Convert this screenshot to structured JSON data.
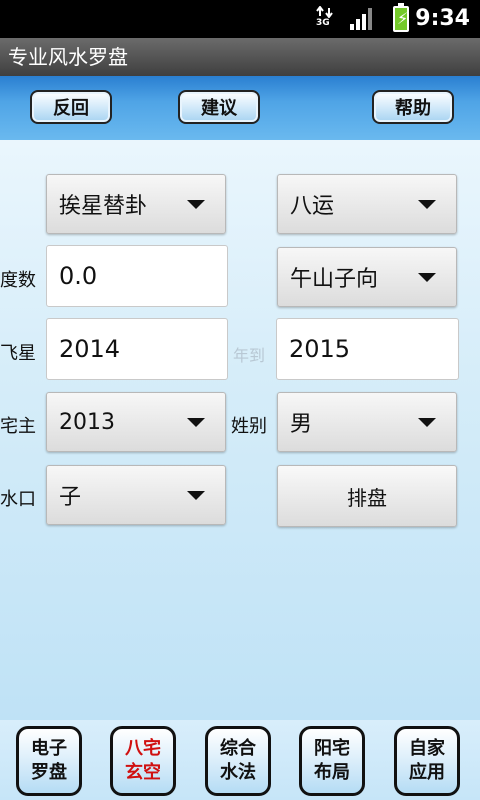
{
  "status_bar": {
    "network": "3G",
    "time": "9:34"
  },
  "app": {
    "title": "专业风水罗盘"
  },
  "toolbar": {
    "back_label": "反回",
    "suggest_label": "建议",
    "help_label": "帮助"
  },
  "form": {
    "method_select": "挨星替卦",
    "period_select": "八运",
    "degree_label": "度数",
    "degree_value": "0.0",
    "direction_select": "午山子向",
    "flystar_label": "飞星",
    "year_from": "2014",
    "year_to_label": "年到",
    "year_to": "2015",
    "owner_label": "宅主",
    "owner_year": "2013",
    "gender_label": "姓别",
    "gender_select": "男",
    "water_label": "水口",
    "water_select": "子",
    "arrange_button": "排盘"
  },
  "bottom_nav": [
    {
      "line1": "电子",
      "line2": "罗盘",
      "active": false
    },
    {
      "line1": "八宅",
      "line2": "玄空",
      "active": true
    },
    {
      "line1": "综合",
      "line2": "水法",
      "active": false
    },
    {
      "line1": "阳宅",
      "line2": "布局",
      "active": false
    },
    {
      "line1": "自家",
      "line2": "应用",
      "active": false
    }
  ],
  "colors": {
    "toolbar_blue": "#4fa4e6",
    "active_tab_red": "#d01010",
    "battery_green": "#74c92a"
  }
}
